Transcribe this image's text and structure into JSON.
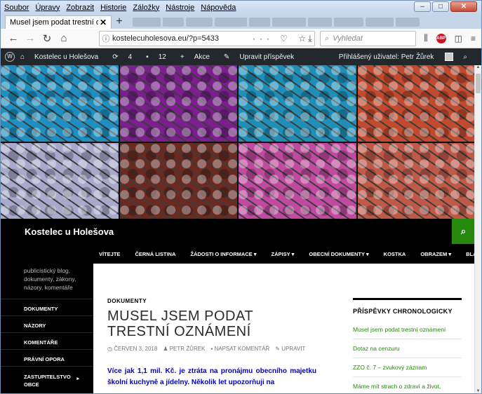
{
  "browser": {
    "menu": [
      "Soubor",
      "Úpravy",
      "Zobrazit",
      "Historie",
      "Záložky",
      "Nástroje",
      "Nápověda"
    ],
    "active_tab_title": "Musel jsem podat trestní oznámení",
    "url": "kostelecuholesova.eu/?p=5433",
    "search_placeholder": "Vyhledat"
  },
  "wp_admin_bar": {
    "site_name": "Kostelec u Holešova",
    "updates_count": "4",
    "comments_count": "12",
    "new_label": "Akce",
    "edit_label": "Upravit příspěvek",
    "logged_in": "Přihlášený uživatel: Petr Žůrek"
  },
  "site": {
    "title": "Kostelec u Holešova",
    "description": "publicistický blog, dokumenty, zákony, názory, komentáře"
  },
  "header_colors": [
    "#1e8fc0",
    "#7a1f8c",
    "#1f8fb8",
    "#c24a2e",
    "#a9a9cc",
    "#6b2a20",
    "#c04aa0",
    "#c05a48"
  ],
  "top_nav": [
    "VÍTEJTE",
    "ČERNÁ LISTINA",
    "ŽÁDOSTI O INFORMACE ▾",
    "ZÁPISY ▾",
    "OBECNÍ DOKUMENTY ▾",
    "KOSTKA",
    "OBRAZEM ▾",
    "BLACKLIST",
    "…"
  ],
  "left_nav": [
    "DOKUMENTY",
    "NÁZORY",
    "KOMENTÁŘE",
    "PRÁVNÍ OPORA",
    "ZASTUPITELSTVO OBCE"
  ],
  "post": {
    "category": "DOKUMENTY",
    "title": "MUSEL JSEM PODAT TRESTNÍ OZNÁMENÍ",
    "date": "ČERVEN 3, 2018",
    "author": "PETR ŽŮREK",
    "comment_link": "NAPSAT KOMENTÁŘ",
    "edit_link": "UPRAVIT",
    "lead": "Více jak 1,1 mil. Kč. je ztráta na pronájmu obecního majetku školní kuchyně a jídelny. Několik let upozorňuji na"
  },
  "sidebar": {
    "heading": "PŘÍSPĚVKY CHRONOLOGICKY",
    "items": [
      "Musel jsem podat trestní oznámení",
      "Dotaz na cenzuru",
      "ZZO č. 7 – zvukový záznam",
      "Máme mít strach o zdraví a život,"
    ]
  }
}
